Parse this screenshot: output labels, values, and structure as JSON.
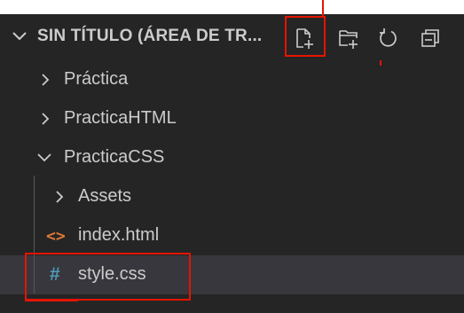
{
  "explorer": {
    "section_title": "SIN TÍTULO (ÁREA DE TR...",
    "actions": {
      "new_file_icon": "new-file-icon",
      "new_folder_icon": "new-folder-icon",
      "refresh_icon": "refresh-icon",
      "collapse_icon": "collapse-all-icon"
    },
    "tree": [
      {
        "label": "Práctica",
        "type": "folder",
        "expanded": false
      },
      {
        "label": "PracticaHTML",
        "type": "folder",
        "expanded": false
      },
      {
        "label": "PracticaCSS",
        "type": "folder",
        "expanded": true
      },
      {
        "label": "Assets",
        "type": "folder",
        "expanded": false
      },
      {
        "label": "index.html",
        "type": "file",
        "icon_glyph": "<>"
      },
      {
        "label": "style.css",
        "type": "file",
        "icon_glyph": "#",
        "selected": true
      }
    ]
  },
  "colors": {
    "background": "#252526",
    "text": "#cccccc",
    "selection": "#37373d",
    "html_icon": "#e37933",
    "css_icon": "#519aba",
    "annotation": "#e51400"
  }
}
